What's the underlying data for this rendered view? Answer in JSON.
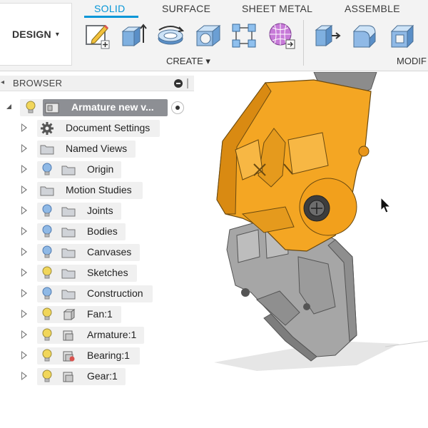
{
  "workspace": {
    "label": "DESIGN",
    "caret": "▾"
  },
  "tabs": [
    {
      "label": "SOLID",
      "active": true
    },
    {
      "label": "SURFACE",
      "active": false
    },
    {
      "label": "SHEET METAL",
      "active": false
    },
    {
      "label": "ASSEMBLE",
      "active": false
    }
  ],
  "groups": {
    "create": "CREATE ▾",
    "modify": "MODIF"
  },
  "tools": [
    "create-sketch-icon",
    "extrude-icon",
    "revolve-icon",
    "hole-icon",
    "pattern-icon",
    "form-icon",
    "press-pull-icon",
    "fillet-icon",
    "shell-icon"
  ],
  "colors": {
    "accent": "#0696d7",
    "bulb_on": "#f1d65a",
    "bulb_blue": "#8fb9e6",
    "folder": "#d0d3d8",
    "model_orange": "#f4a623",
    "model_gray": "#9a9a9a"
  },
  "browser": {
    "title": "BROWSER",
    "root": {
      "label": "Armature new v..."
    },
    "items": [
      {
        "label": "Document Settings",
        "icon": "gear-icon",
        "bulb": "none"
      },
      {
        "label": "Named Views",
        "icon": "folder-icon",
        "bulb": "none"
      },
      {
        "label": "Origin",
        "icon": "folder-icon",
        "bulb": "blue"
      },
      {
        "label": "Motion Studies",
        "icon": "folder-icon",
        "bulb": "none"
      },
      {
        "label": "Joints",
        "icon": "folder-icon",
        "bulb": "blue"
      },
      {
        "label": "Bodies",
        "icon": "folder-icon",
        "bulb": "blue"
      },
      {
        "label": "Canvases",
        "icon": "folder-icon",
        "bulb": "blue"
      },
      {
        "label": "Sketches",
        "icon": "folder-icon",
        "bulb": "yellow"
      },
      {
        "label": "Construction",
        "icon": "folder-icon",
        "bulb": "blue"
      },
      {
        "label": "Fan:1",
        "icon": "component-icon",
        "bulb": "yellow"
      },
      {
        "label": "Armature:1",
        "icon": "component-icon",
        "bulb": "yellow"
      },
      {
        "label": "Bearing:1",
        "icon": "component-linked-icon",
        "bulb": "yellow"
      },
      {
        "label": "Gear:1",
        "icon": "component-icon",
        "bulb": "yellow"
      }
    ]
  }
}
